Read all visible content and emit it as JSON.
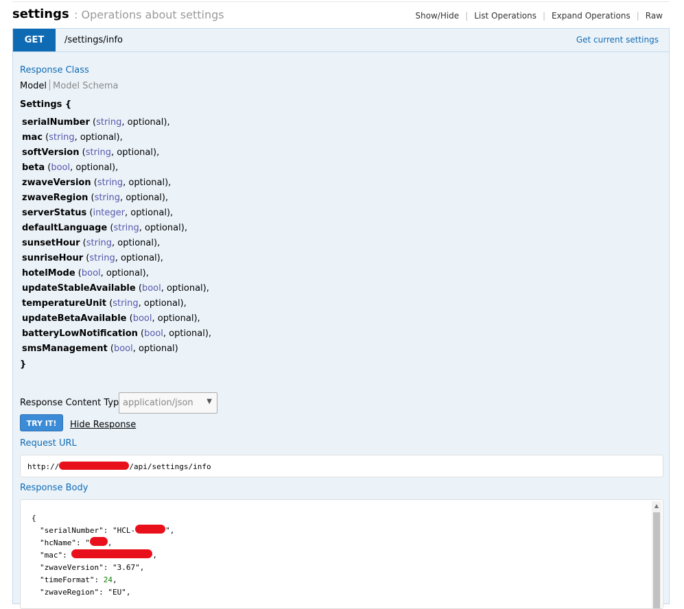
{
  "header": {
    "title": "settings",
    "separator": ":",
    "subtitle": "Operations about settings",
    "links": [
      "Show/Hide",
      "List Operations",
      "Expand Operations",
      "Raw"
    ]
  },
  "operation": {
    "method": "GET",
    "path": "/settings/info",
    "summary": "Get current settings",
    "response_class_label": "Response Class",
    "tabs": {
      "model": "Model",
      "schema": "Model Schema"
    },
    "model_name": "Settings {",
    "model_close": "}",
    "properties": [
      {
        "name": "serialNumber",
        "type": "string",
        "suffix": ", optional),"
      },
      {
        "name": "mac",
        "type": "string",
        "suffix": ", optional),"
      },
      {
        "name": "softVersion",
        "type": "string",
        "suffix": ", optional),"
      },
      {
        "name": "beta",
        "type": "bool",
        "suffix": ", optional),"
      },
      {
        "name": "zwaveVersion",
        "type": "string",
        "suffix": ", optional),"
      },
      {
        "name": "zwaveRegion",
        "type": "string",
        "suffix": ", optional),"
      },
      {
        "name": "serverStatus",
        "type": "integer",
        "suffix": ", optional),"
      },
      {
        "name": "defaultLanguage",
        "type": "string",
        "suffix": ", optional),"
      },
      {
        "name": "sunsetHour",
        "type": "string",
        "suffix": ", optional),"
      },
      {
        "name": "sunriseHour",
        "type": "string",
        "suffix": ", optional),"
      },
      {
        "name": "hotelMode",
        "type": "bool",
        "suffix": ", optional),"
      },
      {
        "name": "updateStableAvailable",
        "type": "bool",
        "suffix": ", optional),"
      },
      {
        "name": "temperatureUnit",
        "type": "string",
        "suffix": ", optional),"
      },
      {
        "name": "updateBetaAvailable",
        "type": "bool",
        "suffix": ", optional),"
      },
      {
        "name": "batteryLowNotification",
        "type": "bool",
        "suffix": ", optional),"
      },
      {
        "name": "smsManagement",
        "type": "bool",
        "suffix": ", optional)"
      }
    ],
    "content_type_label": "Response Content Type",
    "content_type_value": "application/json",
    "try_button": "TRY IT!",
    "hide_response": "Hide Response",
    "request_url_label": "Request URL",
    "request_url_prefix": "http://",
    "request_url_suffix": "/api/settings/info",
    "response_body_label": "Response Body",
    "response_body": {
      "open": "{",
      "lines": [
        {
          "key": "\"serialNumber\": ",
          "value": "\"HCL-",
          "tail": "\",",
          "redacted": true,
          "kind": "str"
        },
        {
          "key": "\"hcName\": ",
          "value": "\"",
          "tail": ",",
          "redacted": true,
          "kind": "str"
        },
        {
          "key": "\"mac\": ",
          "value": "",
          "tail": ",",
          "redacted": true,
          "kind": "str"
        },
        {
          "key": "\"zwaveVersion\": ",
          "value": "\"3.67\"",
          "tail": ",",
          "redacted": false,
          "kind": "str"
        },
        {
          "key": "\"timeFormat\": ",
          "value": "24",
          "tail": ",",
          "redacted": false,
          "kind": "num"
        },
        {
          "key": "\"zwaveRegion\": ",
          "value": "\"EU\"",
          "tail": ",",
          "redacted": false,
          "kind": "str"
        }
      ]
    }
  },
  "colors": {
    "accent": "#0f6ab4",
    "redaction": "#e8101a",
    "panel_bg": "#ebf3f9",
    "type_text": "#5555aa"
  }
}
